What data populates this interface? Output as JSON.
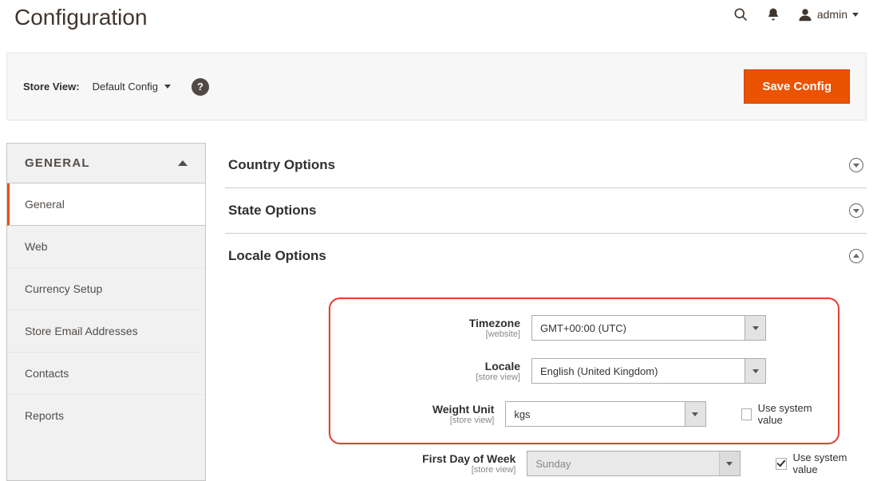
{
  "header": {
    "title": "Configuration",
    "account_label": "admin"
  },
  "toolbar": {
    "store_view_label": "Store View",
    "store_view_value": "Default Config",
    "save_label": "Save Config"
  },
  "sidebar": {
    "group": "GENERAL",
    "items": [
      {
        "label": "General",
        "active": true
      },
      {
        "label": "Web"
      },
      {
        "label": "Currency Setup"
      },
      {
        "label": "Store Email Addresses"
      },
      {
        "label": "Contacts"
      },
      {
        "label": "Reports"
      }
    ]
  },
  "sections": {
    "country": {
      "title": "Country Options"
    },
    "state": {
      "title": "State Options"
    },
    "locale": {
      "title": "Locale Options"
    }
  },
  "fields": {
    "timezone": {
      "label": "Timezone",
      "scope": "[website]",
      "value": "GMT+00:00 (UTC)"
    },
    "locale": {
      "label": "Locale",
      "scope": "[store view]",
      "value": "English (United Kingdom)"
    },
    "weight": {
      "label": "Weight Unit",
      "scope": "[store view]",
      "value": "kgs",
      "use_system": false,
      "use_system_label": "Use system value"
    },
    "firstday": {
      "label": "First Day of Week",
      "scope": "[store view]",
      "value": "Sunday",
      "use_system": true,
      "use_system_label": "Use system value"
    }
  }
}
